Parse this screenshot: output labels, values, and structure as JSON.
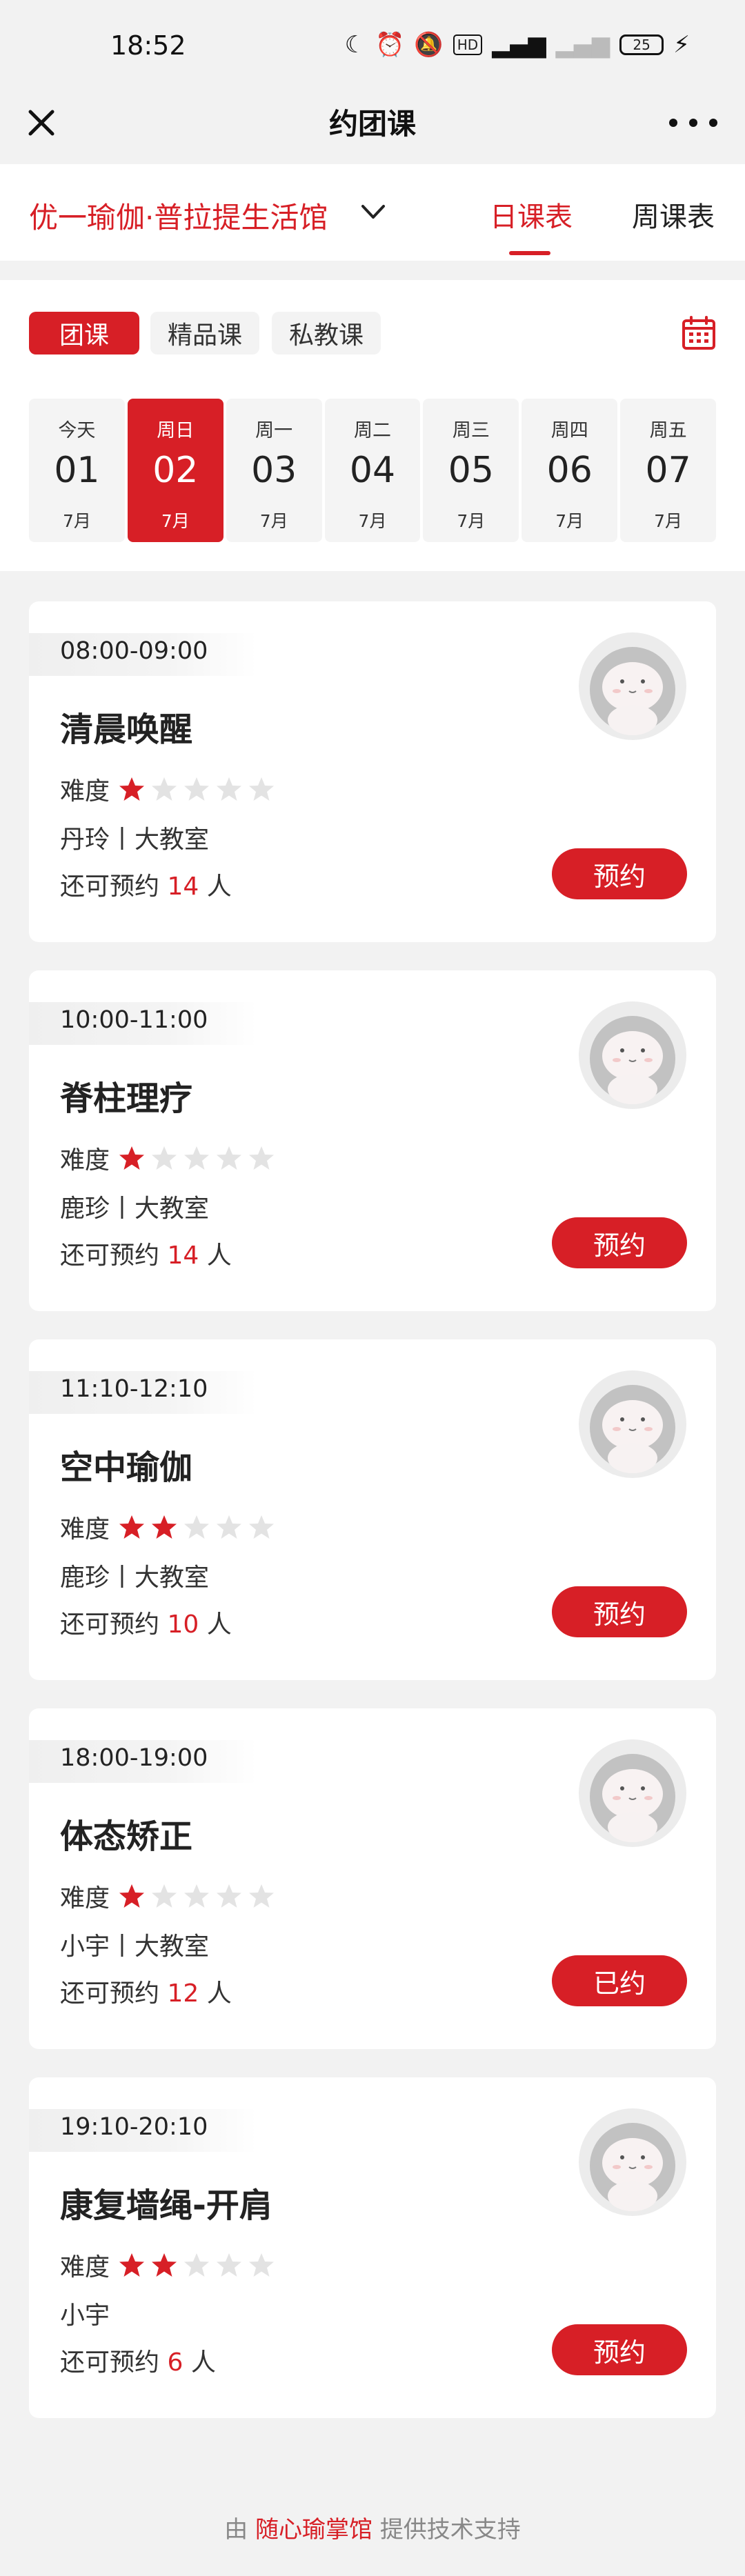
{
  "status_bar": {
    "time": "18:52",
    "battery": "25",
    "hd": "HD"
  },
  "navbar": {
    "title": "约团课"
  },
  "store": {
    "name": "优一瑜伽·普拉提生活馆",
    "tabs": [
      "日课表",
      "周课表"
    ],
    "active_tab": "日课表"
  },
  "filters": {
    "chips": [
      "团课",
      "精品课",
      "私教课"
    ],
    "active_chip": "团课"
  },
  "dates": [
    {
      "weekday": "今天",
      "day": "01",
      "month": "7月",
      "selected": false
    },
    {
      "weekday": "周日",
      "day": "02",
      "month": "7月",
      "selected": true
    },
    {
      "weekday": "周一",
      "day": "03",
      "month": "7月",
      "selected": false
    },
    {
      "weekday": "周二",
      "day": "04",
      "month": "7月",
      "selected": false
    },
    {
      "weekday": "周三",
      "day": "05",
      "month": "7月",
      "selected": false
    },
    {
      "weekday": "周四",
      "day": "06",
      "month": "7月",
      "selected": false
    },
    {
      "weekday": "周五",
      "day": "07",
      "month": "7月",
      "selected": false
    }
  ],
  "classes": [
    {
      "time": "08:00-09:00",
      "name": "清晨唤醒",
      "difficulty_label": "难度",
      "difficulty": 1,
      "teacher": "丹玲丨大教室",
      "avail_prefix": "还可预约",
      "avail_count": "14",
      "avail_suffix": "人",
      "button": "预约"
    },
    {
      "time": "10:00-11:00",
      "name": "脊柱理疗",
      "difficulty_label": "难度",
      "difficulty": 1,
      "teacher": "鹿珍丨大教室",
      "avail_prefix": "还可预约",
      "avail_count": "14",
      "avail_suffix": "人",
      "button": "预约"
    },
    {
      "time": "11:10-12:10",
      "name": "空中瑜伽",
      "difficulty_label": "难度",
      "difficulty": 2,
      "teacher": "鹿珍丨大教室",
      "avail_prefix": "还可预约",
      "avail_count": "10",
      "avail_suffix": "人",
      "button": "预约"
    },
    {
      "time": "18:00-19:00",
      "name": "体态矫正",
      "difficulty_label": "难度",
      "difficulty": 1,
      "teacher": "小宇丨大教室",
      "avail_prefix": "还可预约",
      "avail_count": "12",
      "avail_suffix": "人",
      "button": "已约"
    },
    {
      "time": "19:10-20:10",
      "name": "康复墙绳-开肩",
      "difficulty_label": "难度",
      "difficulty": 2,
      "teacher": "小宇",
      "avail_prefix": "还可预约",
      "avail_count": "6",
      "avail_suffix": "人",
      "button": "预约"
    }
  ],
  "footer": {
    "prefix": "由",
    "brand": "随心瑜掌馆",
    "suffix": "提供技术支持"
  },
  "colors": {
    "accent": "#d71f26",
    "page_bg": "#f2f2f2",
    "star_off": "#e3e3e3"
  }
}
